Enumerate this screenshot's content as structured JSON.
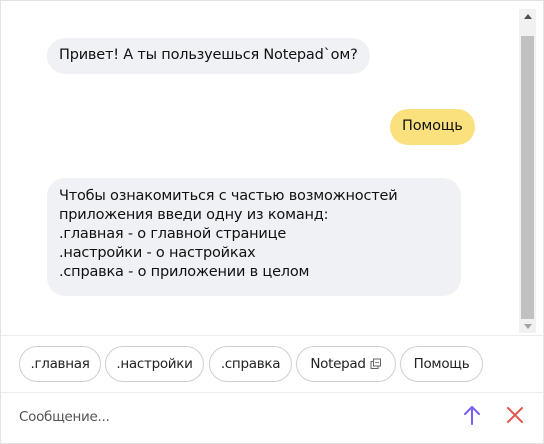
{
  "messages": [
    {
      "sender": "bot",
      "text": "Привет! А ты пользуешься Notepad`ом?"
    },
    {
      "sender": "user",
      "text": "Помощь"
    },
    {
      "sender": "bot",
      "lines": [
        "Чтобы ознакомиться с частью возможностей",
        "приложения введи одну из команд:",
        ".главная - о главной странице",
        ".настройки - о настройках",
        ".справка - о приложении в целом"
      ]
    }
  ],
  "suggestions": [
    {
      "label": ".главная"
    },
    {
      "label": ".настройки"
    },
    {
      "label": ".справка"
    },
    {
      "label": "Notepad",
      "icon": "external-link-icon"
    },
    {
      "label": "Помощь"
    }
  ],
  "input": {
    "placeholder": "Сообщение...",
    "value": ""
  },
  "icons": {
    "send": "arrow-up-icon",
    "close": "close-x-icon"
  },
  "colors": {
    "bot_bubble": "#f0f1f5",
    "user_bubble": "#fbe17d",
    "send": "#7b5cf5",
    "close": "#e2574f"
  }
}
